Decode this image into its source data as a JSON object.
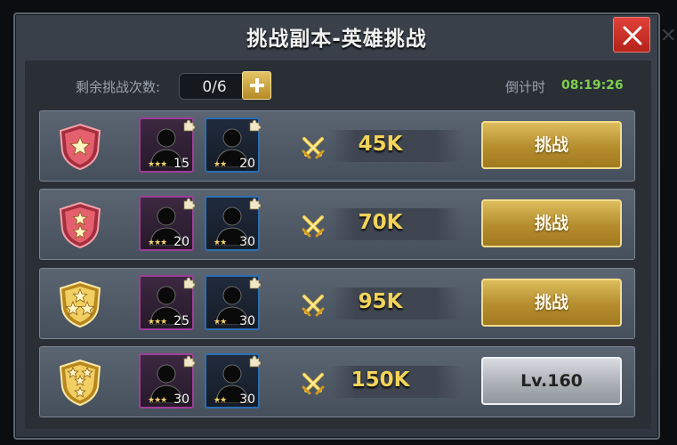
{
  "title": "挑战副本-英雄挑战",
  "count": {
    "label": "剩余挑战次数:",
    "value": "0/6"
  },
  "timer": {
    "label": "倒计时",
    "value": "08:19:26"
  },
  "icons": {
    "close": "close-icon",
    "plus": "plus-icon",
    "power": "crossed-swords-icon",
    "hero": "hero-silhouette-icon",
    "fragment": "puzzle-piece-icon",
    "rank": "shield-rank-icon"
  },
  "colors": {
    "accent_gold": "#f3d35a",
    "timer_green": "#7fce4f",
    "close_red": "#d1352c"
  },
  "rows": [
    {
      "rank_stars": 1,
      "rank_color": "red",
      "hero1": {
        "stars": "★★★",
        "level": "15"
      },
      "hero2": {
        "stars": "★★",
        "level": "20"
      },
      "power": "45K",
      "action": "挑战",
      "action_state": "enabled"
    },
    {
      "rank_stars": 2,
      "rank_color": "red",
      "hero1": {
        "stars": "★★★",
        "level": "20"
      },
      "hero2": {
        "stars": "★★",
        "level": "30"
      },
      "power": "70K",
      "action": "挑战",
      "action_state": "enabled"
    },
    {
      "rank_stars": 3,
      "rank_color": "gold",
      "hero1": {
        "stars": "★★★",
        "level": "25"
      },
      "hero2": {
        "stars": "★★",
        "level": "30"
      },
      "power": "95K",
      "action": "挑战",
      "action_state": "enabled"
    },
    {
      "rank_stars": 4,
      "rank_color": "gold",
      "hero1": {
        "stars": "★★★",
        "level": "30"
      },
      "hero2": {
        "stars": "★★",
        "level": "30"
      },
      "power": "150K",
      "action": "Lv.160",
      "action_state": "locked"
    }
  ]
}
